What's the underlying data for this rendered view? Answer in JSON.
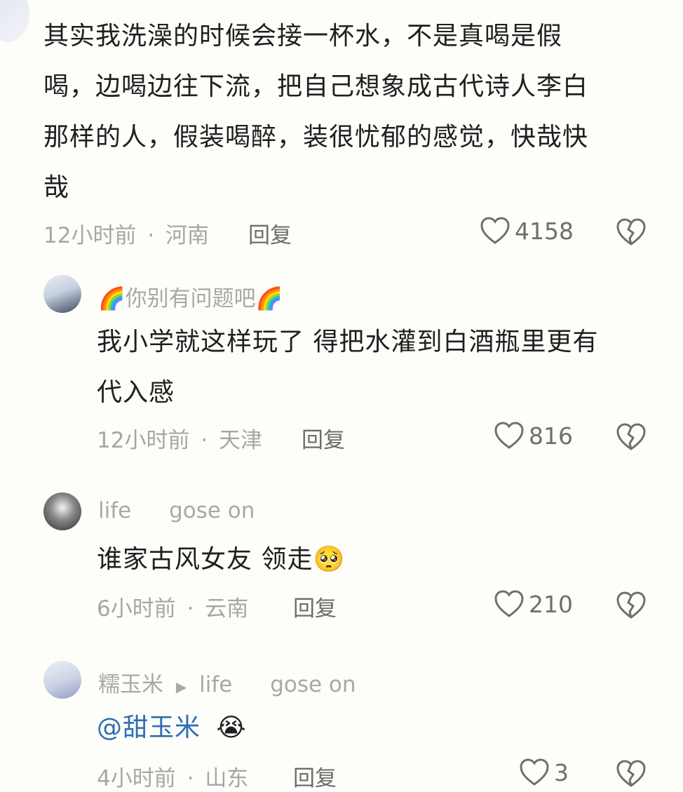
{
  "comments": [
    {
      "text": "其实我洗澡的时候会接一杯水，不是真喝是假喝，边喝边往下流，把自己想象成古代诗人李白那样的人，假装喝醉，装很忧郁的感觉，快哉快哉",
      "lines": [
        "其实我洗澡的时候会接一杯水，不是真喝是假",
        "喝，边喝边往下流，把自己想象成古代诗人李白",
        "那样的人，假装喝醉，装很忧郁的感觉，快哉快",
        "哉"
      ],
      "time": "12小时前",
      "location": "河南",
      "reply_label": "回复",
      "likes": "4158"
    },
    {
      "username": "🌈你别有问题吧🌈",
      "lines": [
        "我小学就这样玩了 得把水灌到白酒瓶里更有",
        "代入感"
      ],
      "time": "12小时前",
      "location": "天津",
      "reply_label": "回复",
      "likes": "816"
    },
    {
      "username": "life",
      "username_suffix": "gose on",
      "text": "谁家古风女友 领走🥺",
      "time": "6小时前",
      "location": "云南",
      "reply_label": "回复",
      "likes": "210"
    },
    {
      "username": "糯玉米",
      "reply_to_arrow": "▶",
      "reply_to": "life",
      "reply_to_suffix": "gose on",
      "mention": "@甜玉米",
      "emoji": "😭",
      "time": "4小时前",
      "location": "山东",
      "reply_label": "回复",
      "likes": "3"
    }
  ],
  "separator": "·",
  "icons": {
    "like": "heart-outline-icon",
    "dislike": "broken-heart-icon"
  },
  "colors": {
    "background": "#fdfdf9",
    "text": "#1f1f1f",
    "meta": "#a6a6a6",
    "mention": "#2e6db5"
  }
}
